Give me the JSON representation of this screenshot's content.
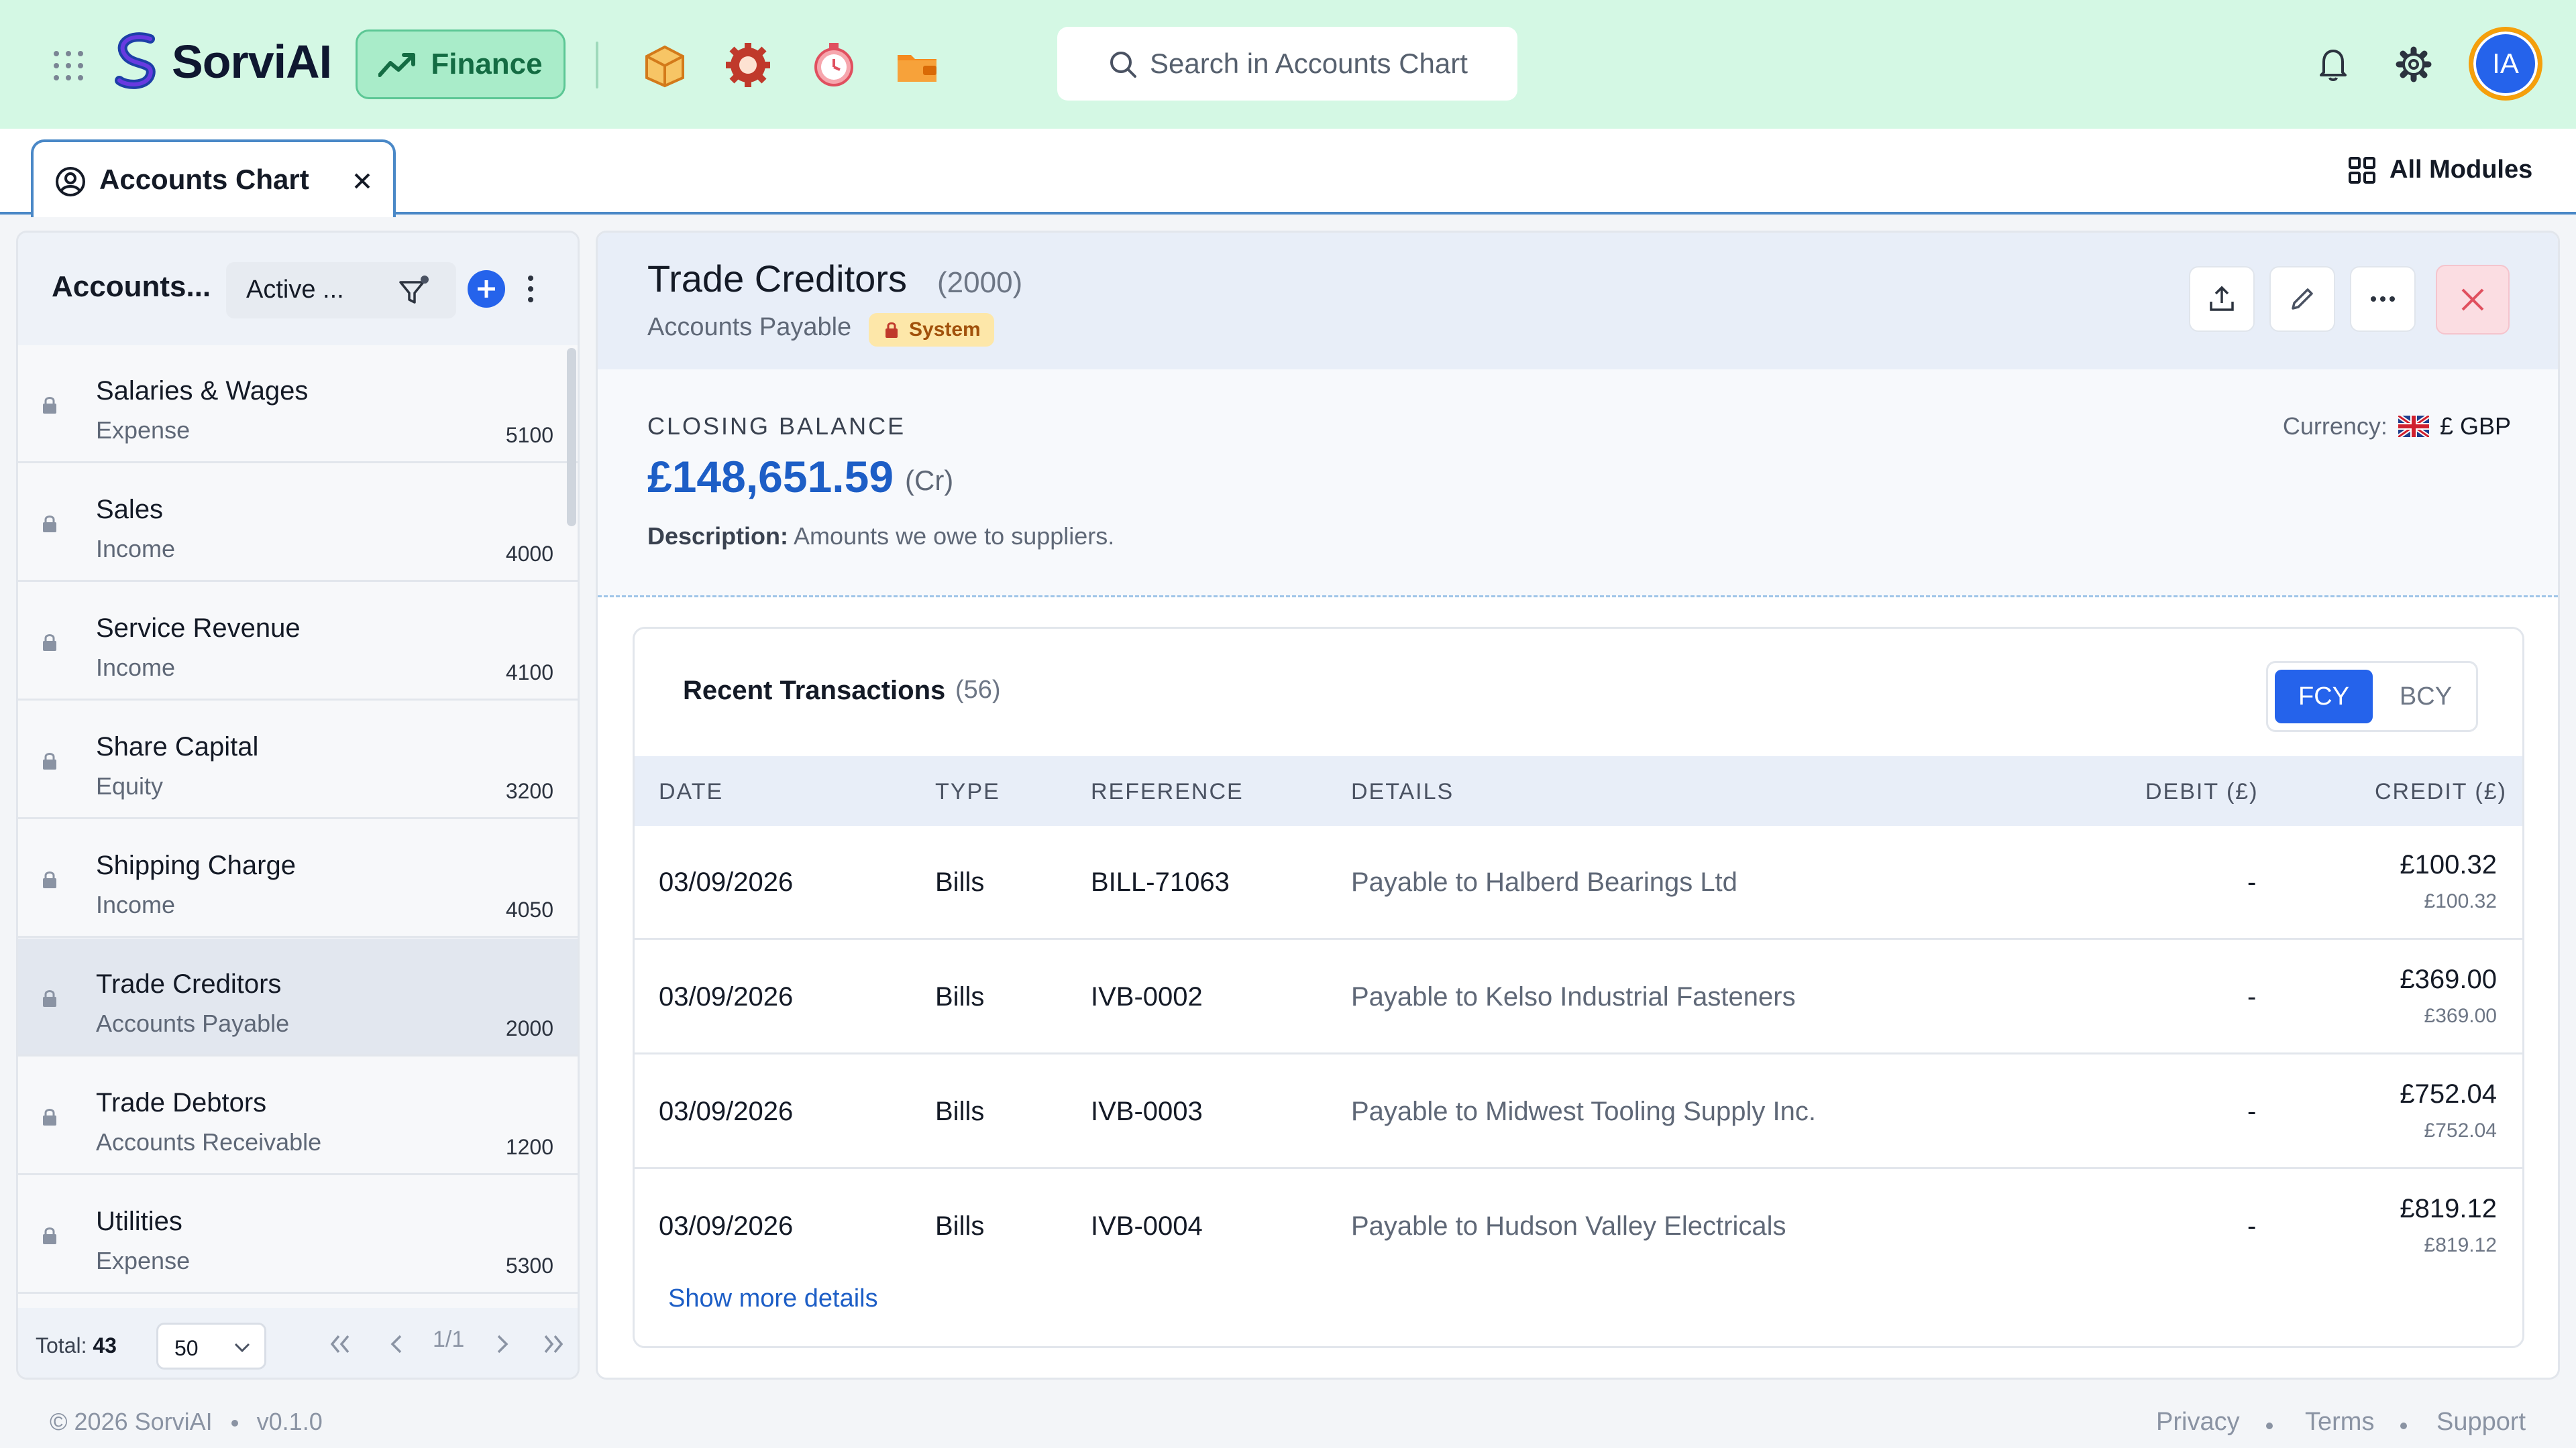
{
  "app": {
    "name": "SorviAI",
    "module": "Finance"
  },
  "search": {
    "placeholder": "Search in Accounts Chart"
  },
  "user": {
    "initials": "IA"
  },
  "tabs": {
    "active": "Accounts Chart",
    "all_modules": "All Modules"
  },
  "sidebar": {
    "title": "Accounts...",
    "filter": "Active ...",
    "items": [
      {
        "name": "Salaries & Wages",
        "type": "Expense",
        "code": "5100"
      },
      {
        "name": "Sales",
        "type": "Income",
        "code": "4000"
      },
      {
        "name": "Service Revenue",
        "type": "Income",
        "code": "4100"
      },
      {
        "name": "Share Capital",
        "type": "Equity",
        "code": "3200"
      },
      {
        "name": "Shipping Charge",
        "type": "Income",
        "code": "4050"
      },
      {
        "name": "Trade Creditors",
        "type": "Accounts Payable",
        "code": "2000"
      },
      {
        "name": "Trade Debtors",
        "type": "Accounts Receivable",
        "code": "1200"
      },
      {
        "name": "Utilities",
        "type": "Expense",
        "code": "5300"
      }
    ],
    "total_label": "Total:",
    "total": "43",
    "per_page": "50",
    "page": "1/1"
  },
  "detail": {
    "title": "Trade Creditors",
    "code": "(2000)",
    "type": "Accounts Payable",
    "badge": "System",
    "closing_label": "CLOSING BALANCE",
    "closing_value": "£148,651.59",
    "closing_side": "(Cr)",
    "desc_label": "Description:",
    "desc": "Amounts we owe to suppliers.",
    "currency_label": "Currency:",
    "currency": "£ GBP"
  },
  "transactions": {
    "title": "Recent Transactions",
    "count": "(56)",
    "toggle": [
      "FCY",
      "BCY"
    ],
    "columns": [
      "DATE",
      "TYPE",
      "REFERENCE",
      "DETAILS",
      "DEBIT (£)",
      "CREDIT (£)"
    ],
    "rows": [
      {
        "date": "03/09/2026",
        "type": "Bills",
        "ref": "BILL-71063",
        "details": "Payable to Halberd Bearings Ltd",
        "debit": "-",
        "credit": "£100.32",
        "credit_base": "£100.32"
      },
      {
        "date": "03/09/2026",
        "type": "Bills",
        "ref": "IVB-0002",
        "details": "Payable to Kelso Industrial Fasteners",
        "debit": "-",
        "credit": "£369.00",
        "credit_base": "£369.00"
      },
      {
        "date": "03/09/2026",
        "type": "Bills",
        "ref": "IVB-0003",
        "details": "Payable to Midwest Tooling Supply Inc.",
        "debit": "-",
        "credit": "£752.04",
        "credit_base": "£752.04"
      },
      {
        "date": "03/09/2026",
        "type": "Bills",
        "ref": "IVB-0004",
        "details": "Payable to Hudson Valley Electricals",
        "debit": "-",
        "credit": "£819.12",
        "credit_base": "£819.12"
      }
    ],
    "show_more": "Show more details"
  },
  "footer": {
    "copyright": "© 2026 SorviAI",
    "version": "v0.1.0",
    "links": [
      "Privacy",
      "Terms",
      "Support"
    ]
  },
  "colors": {
    "topbar": "#d4f8e4",
    "accent": "#2563eb",
    "balance": "#1d5ec6",
    "badge": "#fde7a9"
  }
}
